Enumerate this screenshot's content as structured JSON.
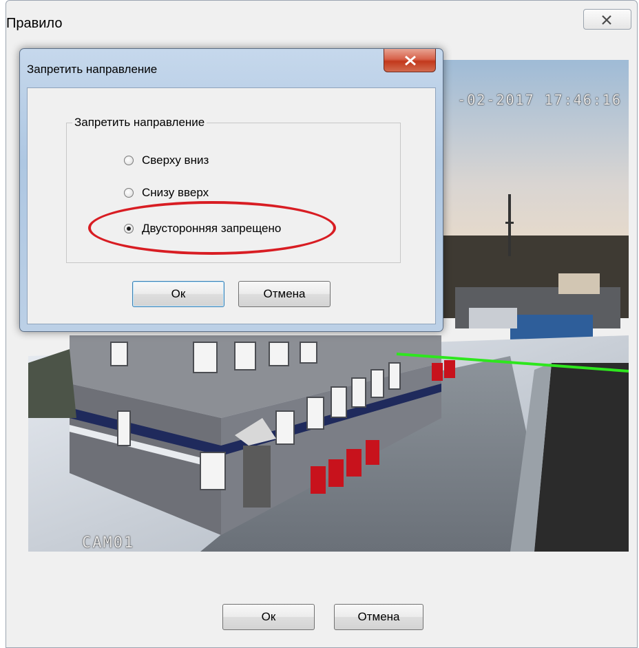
{
  "outer_window": {
    "title": "Правило",
    "ok_label": "Ок",
    "cancel_label": "Отмена"
  },
  "camera": {
    "timestamp": "-02-2017 17:46:16",
    "camera_name": "CAM01"
  },
  "dialog": {
    "title": "Запретить направление",
    "group_label": "Запретить направление",
    "options": [
      {
        "label": "Сверху вниз",
        "checked": false
      },
      {
        "label": "Снизу вверх",
        "checked": false
      },
      {
        "label": "Двусторонняя запрещено",
        "checked": true
      }
    ],
    "ok_label": "Ок",
    "cancel_label": "Отмена"
  },
  "colors": {
    "highlight": "#d81d23",
    "rule_line": "#2ee61e",
    "dialog_frame": "#aec7e2",
    "close_button": "#c2391c"
  },
  "icons": {
    "outer_close": "close-icon",
    "dialog_close": "close-icon"
  }
}
